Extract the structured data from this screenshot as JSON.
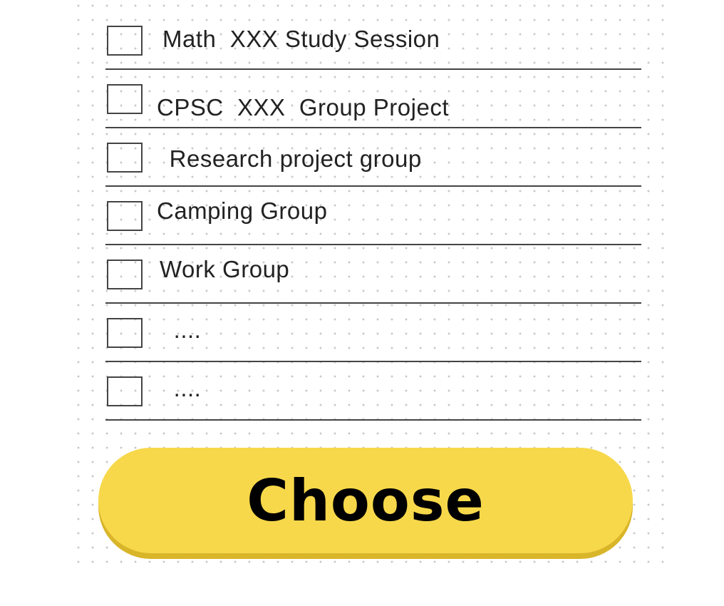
{
  "groups": [
    {
      "label": "Math  XXX Study Session"
    },
    {
      "label": "CPSC  XXX  Group Project"
    },
    {
      "label": " Research project group"
    },
    {
      "label": "Camping Group"
    },
    {
      "label": "Work Group"
    },
    {
      "label": " ...."
    },
    {
      "label": " ...."
    }
  ],
  "actions": {
    "choose_label": "Choose"
  },
  "colors": {
    "button_fill": "#f7d84a",
    "button_shadow": "#d9b52a",
    "line": "#444444",
    "dots": "#c9c9c9"
  }
}
